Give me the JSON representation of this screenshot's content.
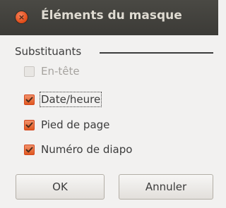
{
  "window": {
    "title": "Éléments du masque",
    "close_glyph": "×"
  },
  "group": {
    "label": "Substituants",
    "items": [
      {
        "label": "En-tête",
        "checked": true,
        "enabled": false
      },
      {
        "label": "Date/heure",
        "checked": true,
        "enabled": true,
        "focused": true
      },
      {
        "label": "Pied de page",
        "checked": true,
        "enabled": true
      },
      {
        "label": "Numéro de diapo",
        "checked": true,
        "enabled": true
      }
    ]
  },
  "buttons": {
    "ok_label": "OK",
    "cancel_label": "Annuler"
  },
  "colors": {
    "titlebar": "#3c3b37",
    "accent": "#e0581f",
    "background": "#f2f1f0"
  }
}
